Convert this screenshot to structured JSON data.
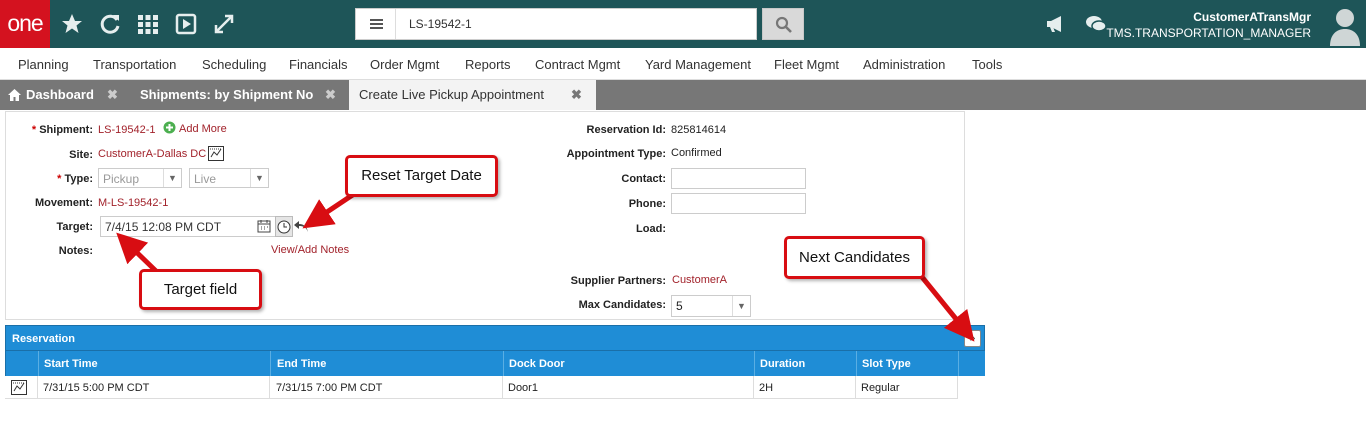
{
  "app": {
    "logo": "one",
    "search_value": "LS-19542-1",
    "user_name": "CustomerATransMgr",
    "user_role": "TMS.TRANSPORTATION_MANAGER"
  },
  "menu": [
    "Planning",
    "Transportation",
    "Scheduling",
    "Financials",
    "Order Mgmt",
    "Reports",
    "Contract Mgmt",
    "Yard Management",
    "Fleet Mgmt",
    "Administration",
    "Tools"
  ],
  "tabs": [
    {
      "label": "Dashboard",
      "close": "✖"
    },
    {
      "label": "Shipments: by Shipment No",
      "close": "✖"
    },
    {
      "label": "Create Live Pickup Appointment",
      "close": "✖"
    }
  ],
  "form": {
    "shipment_label": "Shipment:",
    "shipment_value": "LS-19542-1",
    "add_more": "Add More",
    "site_label": "Site:",
    "site_value": "CustomerA-Dallas DC",
    "type_label": "Type:",
    "type_value": "Pickup",
    "type2_value": "Live",
    "movement_label": "Movement:",
    "movement_value": "M-LS-19542-1",
    "target_label": "Target:",
    "target_value": "7/4/15 12:08 PM CDT",
    "notes_label": "Notes:",
    "view_notes": "View/Add Notes",
    "reservation_id_label": "Reservation Id:",
    "reservation_id_value": "825814614",
    "appointment_type_label": "Appointment Type:",
    "appointment_type_value": "Confirmed",
    "contact_label": "Contact:",
    "phone_label": "Phone:",
    "load_label": "Load:",
    "supplier_label": "Supplier Partners:",
    "supplier_value": "CustomerA",
    "max_candidates_label": "Max Candidates:",
    "max_candidates_value": "5",
    "required_mark": "*"
  },
  "callouts": {
    "reset_target_date": "Reset Target Date",
    "target_field": "Target field",
    "next_candidates": "Next Candidates"
  },
  "reservation": {
    "title": "Reservation",
    "next_glyph": "»",
    "columns": [
      "Start Time",
      "End Time",
      "Dock Door",
      "Duration",
      "Slot Type"
    ],
    "rows": [
      {
        "start": "7/31/15 5:00 PM CDT",
        "end": "7/31/15 7:00 PM CDT",
        "door": "Door1",
        "duration": "2H",
        "slot": "Regular"
      }
    ]
  },
  "colors": {
    "topbar": "#1e5558",
    "logo": "#d4121f",
    "accent_blue": "#1f8dd6",
    "link_red": "#a2222b",
    "callout_red": "#d80d12"
  }
}
